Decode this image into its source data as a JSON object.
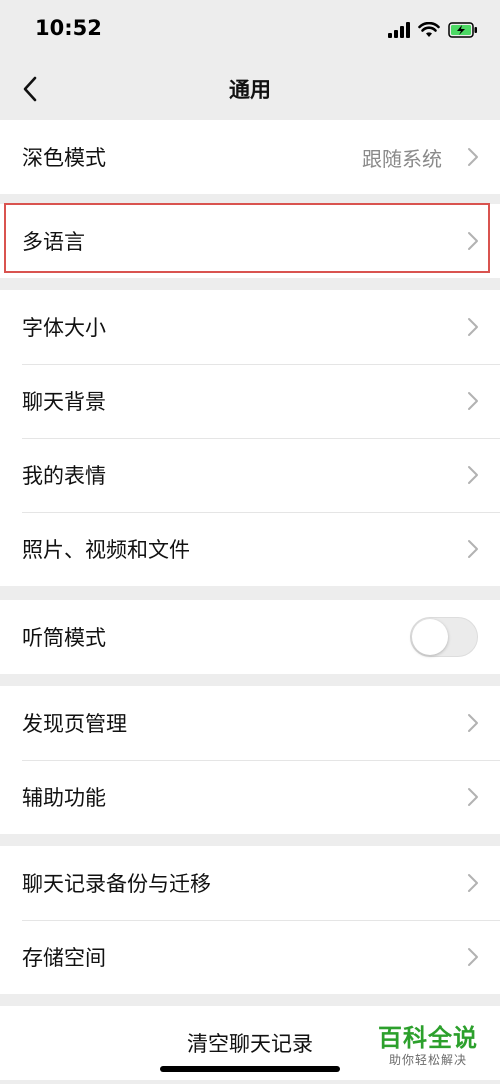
{
  "status_bar": {
    "time": "10:52",
    "icons": [
      "cellular-signal-icon",
      "wifi-icon",
      "battery-charging-icon"
    ],
    "battery_color": "#4cd964"
  },
  "nav": {
    "title": "通用",
    "back_icon": "chevron-left-icon"
  },
  "groups": {
    "display": {
      "dark_mode": {
        "label": "深色模式",
        "value": "跟随系统"
      }
    },
    "language": {
      "multi_language": {
        "label": "多语言"
      },
      "highlight_color": "#d9534f"
    },
    "appearance": {
      "items": [
        {
          "label": "字体大小"
        },
        {
          "label": "聊天背景"
        },
        {
          "label": "我的表情"
        },
        {
          "label": "照片、视频和文件"
        }
      ]
    },
    "earpiece": {
      "label": "听筒模式",
      "toggle_on": false
    },
    "features": {
      "items": [
        {
          "label": "发现页管理"
        },
        {
          "label": "辅助功能"
        }
      ]
    },
    "storage": {
      "items": [
        {
          "label": "聊天记录备份与迁移"
        },
        {
          "label": "存储空间"
        }
      ]
    }
  },
  "clear_chat": {
    "label": "清空聊天记录"
  },
  "watermark": {
    "title": "百科全说",
    "subtitle": "助你轻松解决",
    "color": "#2ca02c"
  }
}
